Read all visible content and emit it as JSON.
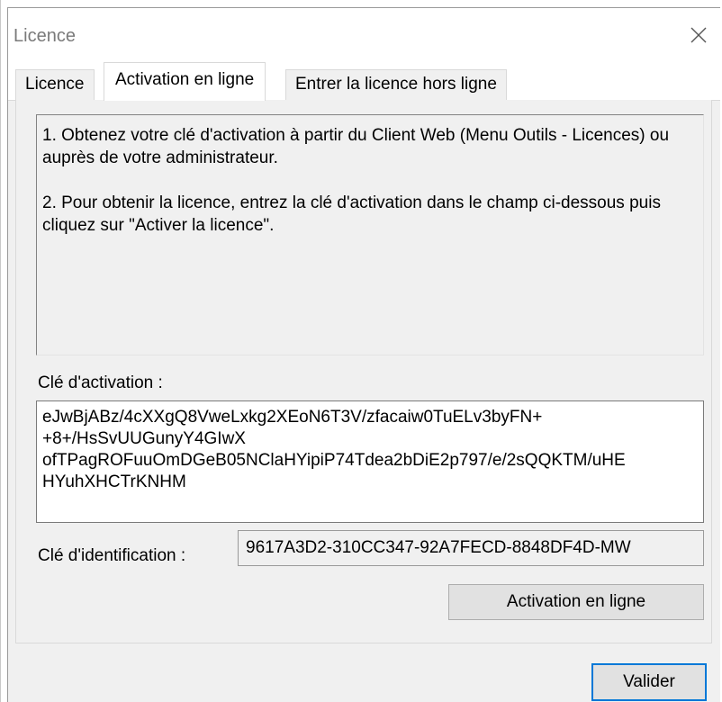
{
  "window": {
    "title": "Licence",
    "close_icon": "close-icon"
  },
  "tabs": [
    {
      "label": "Licence",
      "active": false
    },
    {
      "label": "Activation en ligne",
      "active": true
    },
    {
      "label": "Entrer la licence hors ligne",
      "active": false
    }
  ],
  "instructions": {
    "paragraph1": "1. Obtenez votre clé d'activation à partir du Client Web (Menu Outils - Licences) ou\nauprès de votre administrateur.",
    "paragraph2": "2. Pour obtenir la licence, entrez la clé d'activation dans le champ ci-dessous puis cliquez sur \"Activer la licence\"."
  },
  "activation": {
    "label": "Clé d'activation :",
    "value": "eJwBjABz/4cXXgQ8VweLxkg2XEoN6T3V/zfacaiw0TuELv3byFN+ +8+/HsSvUUGunyY4GIwX ofTPagROFuuOmDGeB05NClaHYipiP74Tdea2bDiE2p797/e/2sQQKTM/uHE HYuhXHCTrKNHM",
    "lines": [
      "eJwBjABz/4cXXgQ8VweLxkg2XEoN6T3V/zfacaiw0TuELv3byFN+",
      "+8+/HsSvUUGunyY4GIwX",
      "ofTPagROFuuOmDGeB05NClaHYipiP74Tdea2bDiE2p797/e/2sQQKTM/uHE",
      "HYuhXHCTrKNHM"
    ]
  },
  "identification": {
    "label": "Clé d'identification :",
    "value": "9617A3D2-310CC347-92A7FECD-8848DF4D-MW"
  },
  "buttons": {
    "online_activation": "Activation en ligne",
    "ok": "Valider"
  },
  "colors": {
    "focus_border": "#0078d7",
    "dialog_bg": "#f0f0f0"
  }
}
